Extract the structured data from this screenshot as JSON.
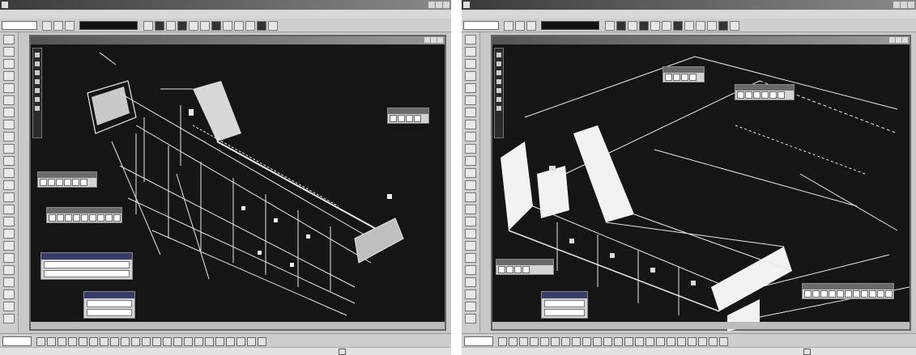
{
  "colors": {
    "desktop_gray": "#c8c8c8",
    "viewport_bg": "#151515",
    "model_lines": "#e8e8e8"
  },
  "left_window": {
    "icons": [
      "app-icon",
      "minimize-icon",
      "maximize-icon",
      "close-icon",
      "tool-icon",
      "view-icon"
    ]
  },
  "right_window": {
    "icons": [
      "app-icon",
      "minimize-icon",
      "maximize-icon",
      "close-icon",
      "tool-icon",
      "view-icon"
    ]
  }
}
